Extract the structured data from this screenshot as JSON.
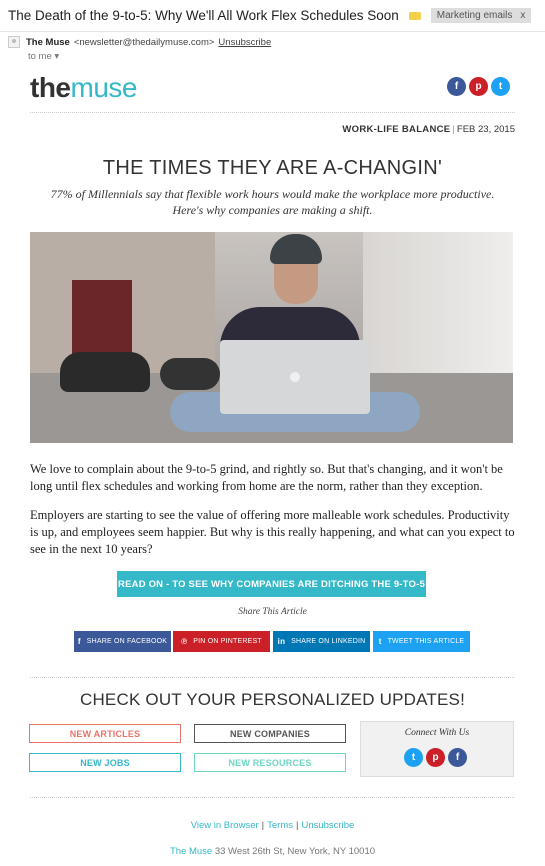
{
  "email": {
    "subject": "The Death of the 9-to-5: Why We'll All Work Flex Schedules Soon",
    "label": "Marketing emails",
    "label_close": "x",
    "sender_name": "The Muse",
    "sender_email": "<newsletter@thedailymuse.com>",
    "unsubscribe": "Unsubscribe",
    "to": "to me"
  },
  "brand": {
    "logo_the": "the",
    "logo_muse": "muse",
    "accent": "#35b8c8"
  },
  "social_top": [
    "facebook-icon",
    "pinterest-icon",
    "twitter-icon"
  ],
  "article": {
    "category": "WORK-LIFE BALANCE",
    "date": "FEB 23, 2015",
    "headline": "THE TIMES THEY ARE A-CHANGIN'",
    "subhead": "77% of Millennials say that flexible work hours would make the workplace more productive. Here's why companies are making a shift.",
    "para1": "We love to complain about the 9-to-5 grind, and rightly so. But that's changing, and it won't be long until flex schedules and working from home are the norm, rather than they exception.",
    "para2": "Employers are starting to see the value of offering more malleable work schedules. Productivity is up, and employees seem happier. But why is this really happening, and what can you expect to see in the next 10 years?",
    "cta": "READ ON - TO SEE WHY COMPANIES ARE DITCHING THE 9-TO-5"
  },
  "share": {
    "title": "Share This Article",
    "facebook": "SHARE ON FACEBOOK",
    "pinterest": "PIN ON PINTEREST",
    "linkedin": "SHARE ON LINKEDIN",
    "twitter": "TWEET THIS ARTICLE"
  },
  "updates": {
    "title": "CHECK OUT YOUR PERSONALIZED UPDATES!",
    "articles": "NEW ARTICLES",
    "companies": "NEW COMPANIES",
    "jobs": "NEW JOBS",
    "resources": "NEW RESOURCES",
    "connect_title": "Connect With Us"
  },
  "footer": {
    "view_browser": "View in Browser",
    "terms": "Terms",
    "unsubscribe": "Unsubscribe",
    "brand": "The Muse",
    "address": "33 West 26th St, New York, NY 10010"
  }
}
